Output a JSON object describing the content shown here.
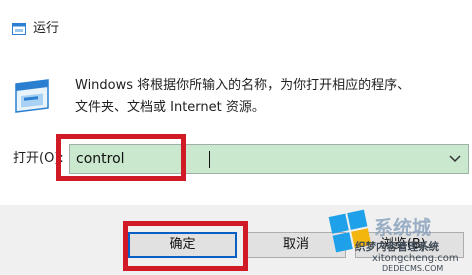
{
  "window": {
    "title": "运行"
  },
  "description": {
    "line1": "Windows 将根据你所输入的名称，为你打开相应的程序、",
    "line2": "文件夹、文档或 Internet 资源。"
  },
  "open_field": {
    "label": "打开(O):",
    "value": "control"
  },
  "buttons": {
    "ok_label": "确定",
    "cancel_label": "取消",
    "browse_label": "浏览(B)..."
  },
  "watermark": {
    "title": "系统城",
    "subtitle": "织梦内容管理系统",
    "domain": "xitongcheng.com",
    "domain2": "DEDECMS.COM"
  },
  "colors": {
    "input_background": "#c9e8cd",
    "highlight_border": "#d01b26",
    "ok_button_border": "#0a5fc4",
    "bottom_bar": "#f0f0f0"
  },
  "icons": {
    "title": "run-icon",
    "dialog": "run-app-icon",
    "dropdown": "chevron-down-icon",
    "watermark": "windows-logo-icon"
  }
}
